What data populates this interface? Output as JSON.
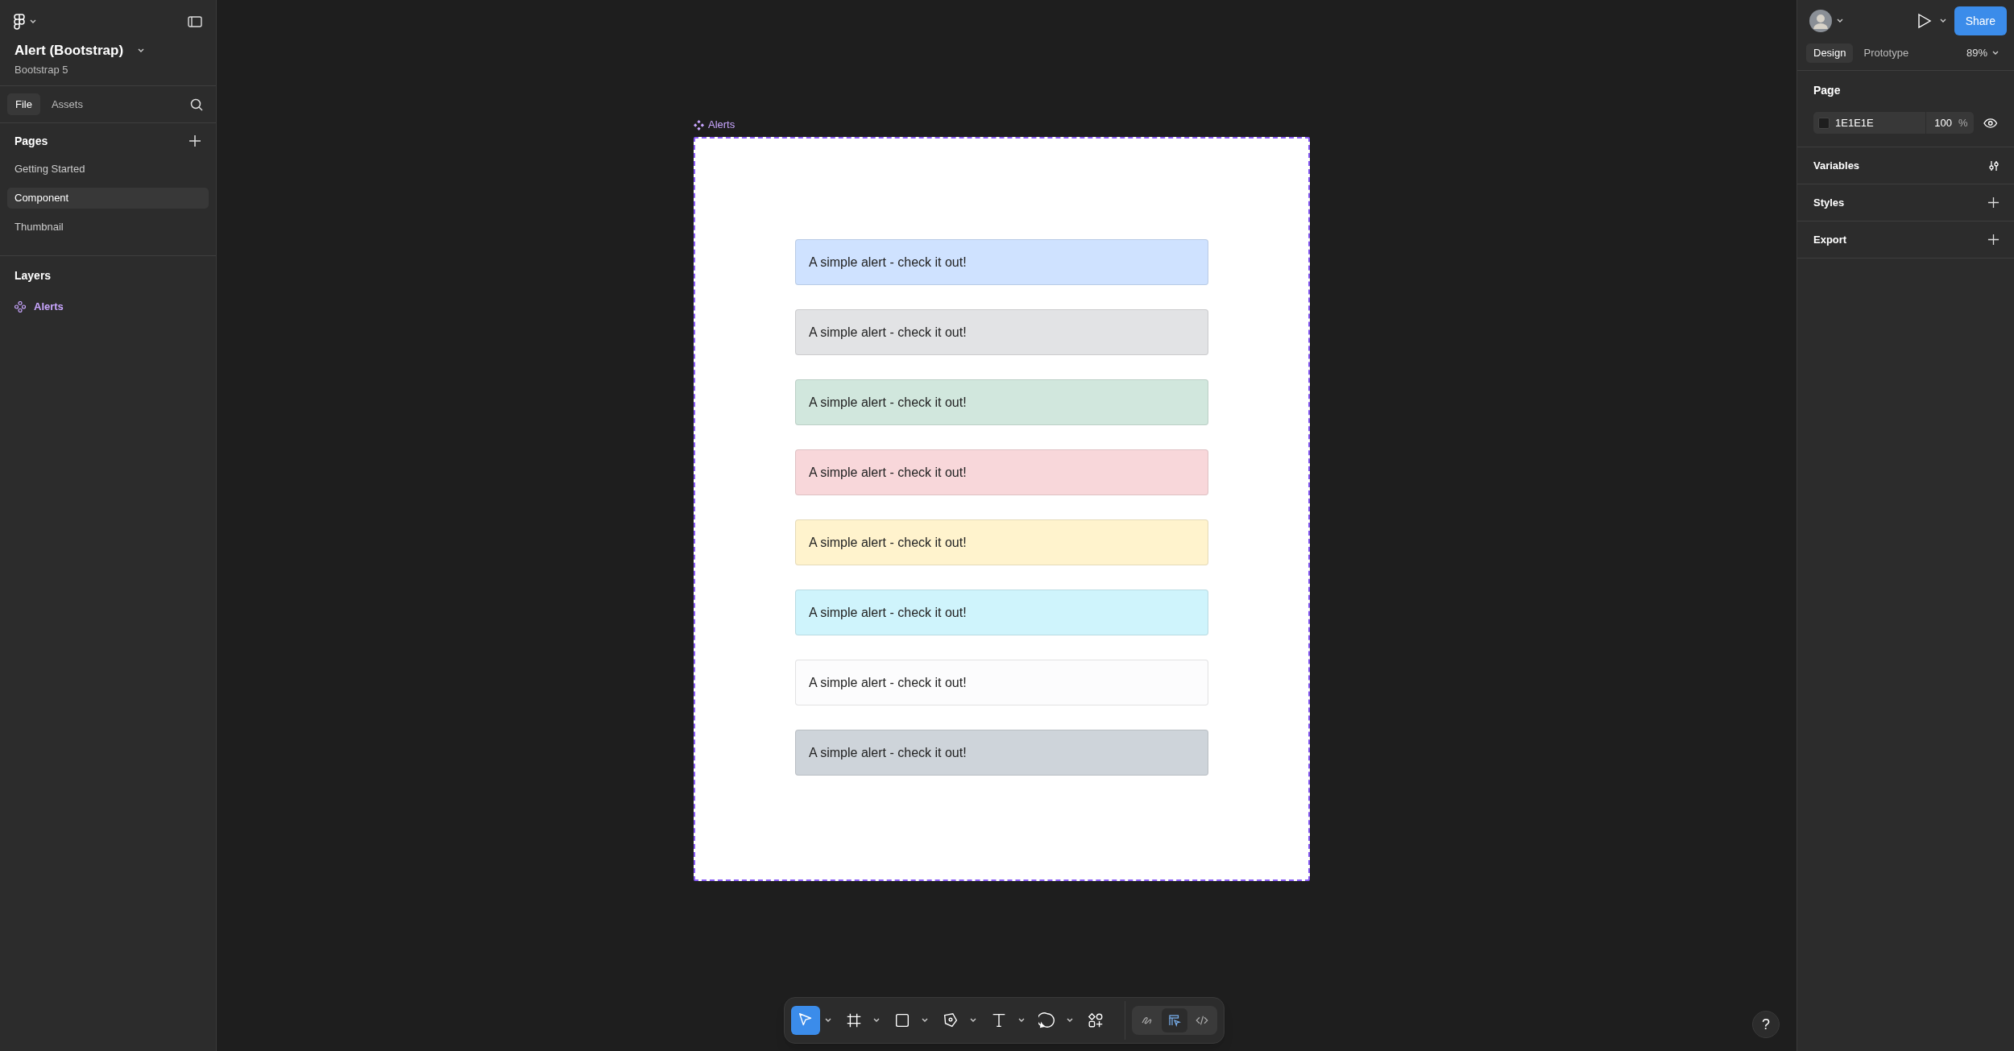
{
  "file": {
    "title": "Alert (Bootstrap)",
    "subtitle": "Bootstrap 5"
  },
  "left_tabs": [
    {
      "label": "File",
      "selected": true
    },
    {
      "label": "Assets",
      "selected": false
    }
  ],
  "pages": {
    "title": "Pages",
    "items": [
      {
        "label": "Getting Started",
        "selected": false
      },
      {
        "label": "Component",
        "selected": true
      },
      {
        "label": "Thumbnail",
        "selected": false
      }
    ]
  },
  "layers": {
    "title": "Layers",
    "items": [
      {
        "label": "Alerts"
      }
    ]
  },
  "canvas": {
    "frame_label": "Alerts",
    "alerts": [
      {
        "text": "A simple alert - check it out!",
        "color": "#cfe2ff"
      },
      {
        "text": "A simple alert - check it out!",
        "color": "#e2e3e5"
      },
      {
        "text": "A simple alert - check it out!",
        "color": "#d1e7dd"
      },
      {
        "text": "A simple alert - check it out!",
        "color": "#f8d7da"
      },
      {
        "text": "A simple alert - check it out!",
        "color": "#fff3cd"
      },
      {
        "text": "A simple alert - check it out!",
        "color": "#cff4fc"
      },
      {
        "text": "A simple alert - check it out!",
        "color": "#fcfcfd"
      },
      {
        "text": "A simple alert - check it out!",
        "color": "#ced4da"
      }
    ]
  },
  "toolbar": {
    "tools": [
      {
        "selected": true,
        "dropdown": true
      },
      {
        "selected": false,
        "dropdown": true
      },
      {
        "selected": false,
        "dropdown": true
      },
      {
        "selected": false,
        "dropdown": true
      },
      {
        "selected": false,
        "dropdown": true
      },
      {
        "selected": false,
        "dropdown": true
      },
      {
        "selected": false,
        "dropdown": false
      }
    ],
    "modes": [
      {
        "selected": false
      },
      {
        "selected": true
      },
      {
        "selected": false
      }
    ]
  },
  "right_panel": {
    "share": "Share",
    "tabs": [
      {
        "label": "Design",
        "selected": true
      },
      {
        "label": "Prototype",
        "selected": false
      }
    ],
    "zoom": "89%",
    "page": {
      "title": "Page",
      "color_value": "1E1E1E",
      "opacity": "100",
      "unit": "%"
    },
    "sections": [
      {
        "title": "Variables",
        "kind": "sliders"
      },
      {
        "title": "Styles",
        "kind": "add"
      },
      {
        "title": "Export",
        "kind": "add"
      }
    ]
  },
  "help": "?"
}
